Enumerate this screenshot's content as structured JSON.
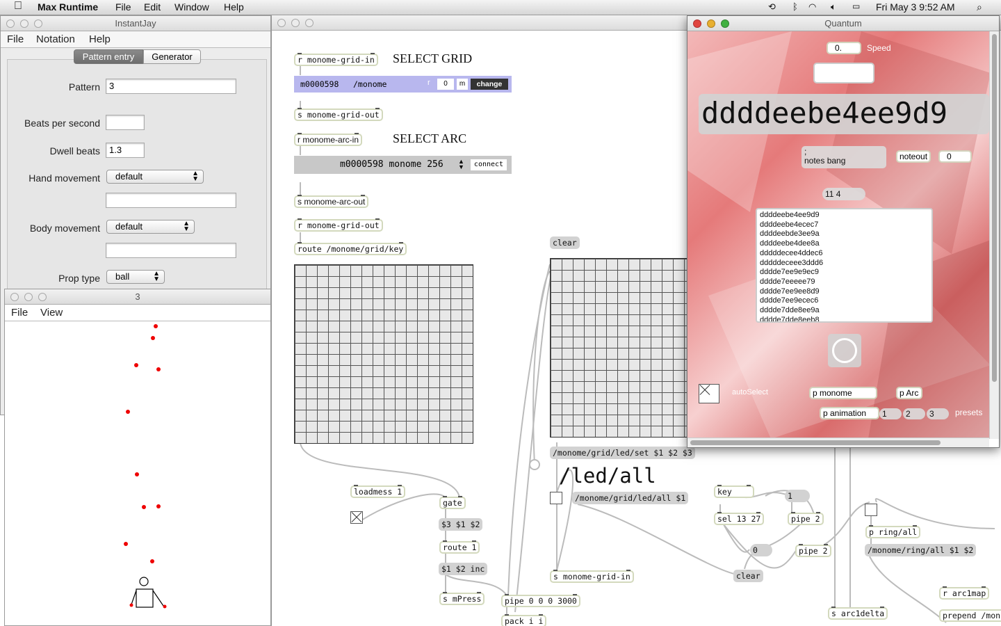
{
  "menubar": {
    "apple": "",
    "app_name": "Max Runtime",
    "items": [
      "File",
      "Edit",
      "Window",
      "Help"
    ],
    "clock": "Fri May 3  9:52 AM"
  },
  "instantjay": {
    "title": "InstantJay",
    "menu": [
      "File",
      "Notation",
      "Help"
    ],
    "tabs": [
      "Pattern entry",
      "Generator"
    ],
    "pattern_label": "Pattern",
    "pattern_value": "3",
    "beats_label": "Beats per second",
    "beats_value": "",
    "dwell_label": "Dwell beats",
    "dwell_value": "1.3",
    "hand_label": "Hand movement",
    "hand_value": "default",
    "body_label": "Body movement",
    "body_value": "default",
    "prop_label": "Prop type",
    "prop_value": "ball"
  },
  "animwin": {
    "title": "3",
    "menu": [
      "File",
      "View"
    ]
  },
  "patcher": {
    "r_grid_in": "r monome-grid-in",
    "select_grid": "SELECT GRID",
    "serialosc_grid": {
      "id": "m0000598",
      "prefix": "/monome",
      "r": "r",
      "rot": "0",
      "m": "m",
      "change": "change"
    },
    "s_grid_out": "s monome-grid-out",
    "r_arc_in": "r monome-arc-in",
    "select_arc": "SELECT ARC",
    "arc_menu": "m0000598 monome 256",
    "connect": "connect",
    "s_arc_out": "s monome-arc-out",
    "r_grid_out": "r monome-grid-out",
    "route_key": "route /monome/grid/key",
    "clear1": "clear",
    "led_set": "/monome/grid/led/set $1 $2 $3",
    "led_all_big": "/led/all",
    "led_all_msg": "/monome/grid/led/all $1",
    "loadmess": "loadmess 1",
    "gate": "gate",
    "msg_312": "$3 $1 $2",
    "route1": "route 1",
    "inc": "$1 $2 inc",
    "s_mpress": "s mPress",
    "pipe4": "pipe 0 0 0 3000",
    "pack": "pack i i",
    "s_grid_in": "s monome-grid-in",
    "key": "key",
    "one": "1",
    "sel": "sel 13 27",
    "pipe2a": "pipe 2",
    "zero": "0",
    "pipe2b": "pipe 2",
    "clear2": "clear",
    "p_ring_all": "p ring/all",
    "ring_all_msg": "/monome/ring/all $1 $2",
    "s_arcdelta": "s arc1delta",
    "r_arc1map": "r arc1map",
    "prepend": "prepend /mon"
  },
  "quantum": {
    "title": "Quantum",
    "speed_value": "0.",
    "speed_label": "Speed",
    "big_hex": "ddddeebe4ee9d9",
    "notes_bang": ";\nnotes bang",
    "noteout": "noteout",
    "noteout_val": "0",
    "counter": "11 4",
    "list": [
      "ddddeebe4ee9d9",
      "ddddeebe4ecec7",
      "ddddeebde3ee9a",
      "ddddeebe4dee8a",
      "dddddecee4ddec6",
      "dddddeceee3ddd6",
      "dddde7ee9e9ec9",
      "dddde7eeeee79",
      "dddde7ee9ee8d9",
      "dddde7ee9ecec6",
      "dddde7dde8ee9a",
      "dddde7dde8eeb8"
    ],
    "autoselect": "autoSelect",
    "p_monome": "p monome",
    "p_arc": "p Arc",
    "p_animation": "p animation",
    "presets": [
      "1",
      "2",
      "3"
    ],
    "presets_label": "presets"
  }
}
